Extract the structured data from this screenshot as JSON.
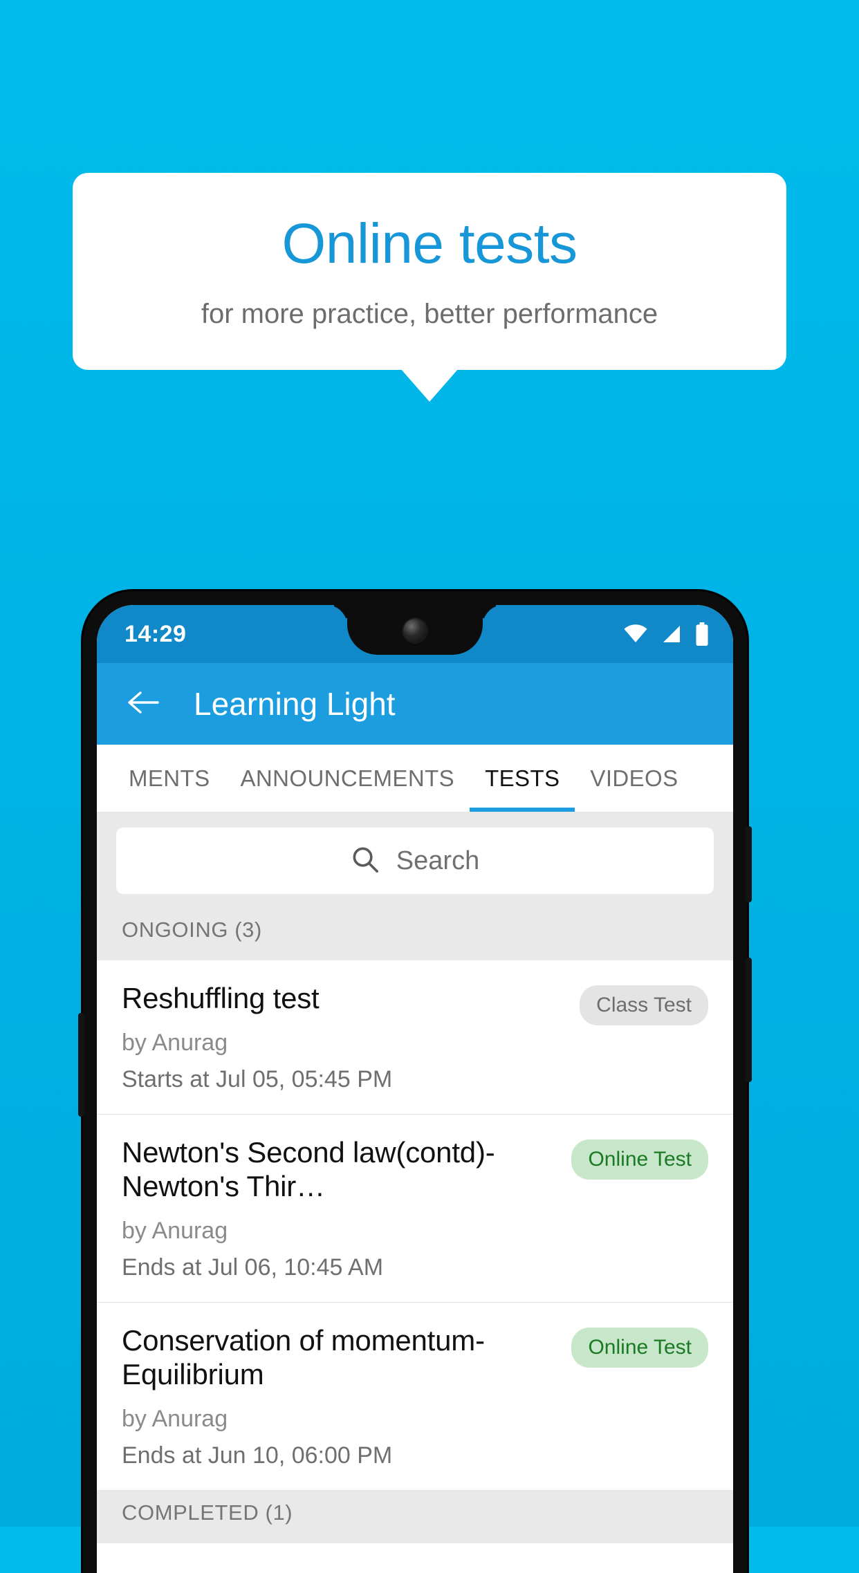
{
  "promo": {
    "title": "Online tests",
    "subtitle": "for more practice, better performance",
    "title_color": "#1796D8",
    "subtitle_color": "#6C6C6C",
    "background_color": "#00BCEC"
  },
  "statusbar": {
    "time": "14:29",
    "icons": [
      "wifi-icon",
      "signal-icon",
      "battery-icon"
    ]
  },
  "appbar": {
    "back_icon": "arrow-left-icon",
    "title": "Learning Light",
    "background_color": "#1C9DE0"
  },
  "tabs": [
    {
      "label": "MENTS",
      "active": false
    },
    {
      "label": "ANNOUNCEMENTS",
      "active": false
    },
    {
      "label": "TESTS",
      "active": true
    },
    {
      "label": "VIDEOS",
      "active": false
    }
  ],
  "search": {
    "icon": "search-icon",
    "placeholder": "Search",
    "value": ""
  },
  "sections": [
    {
      "label": "ONGOING (3)"
    },
    {
      "label": "COMPLETED (1)"
    }
  ],
  "tests": [
    {
      "title": "Reshuffling test",
      "author": "by Anurag",
      "time": "Starts at  Jul 05, 05:45 PM",
      "badge": "Class Test",
      "badge_type": "class",
      "badge_bg": "#E4E4E4",
      "badge_color": "#6D6D6D"
    },
    {
      "title": "Newton's Second law(contd)-Newton's Thir…",
      "author": "by Anurag",
      "time": "Ends at  Jul 06, 10:45 AM",
      "badge": "Online Test",
      "badge_type": "online",
      "badge_bg": "#C8E6C9",
      "badge_color": "#1B7A24"
    },
    {
      "title": "Conservation of momentum-Equilibrium",
      "author": "by Anurag",
      "time": "Ends at  Jun 10, 06:00 PM",
      "badge": "Online Test",
      "badge_type": "online",
      "badge_bg": "#C8E6C9",
      "badge_color": "#1B7A24"
    }
  ]
}
